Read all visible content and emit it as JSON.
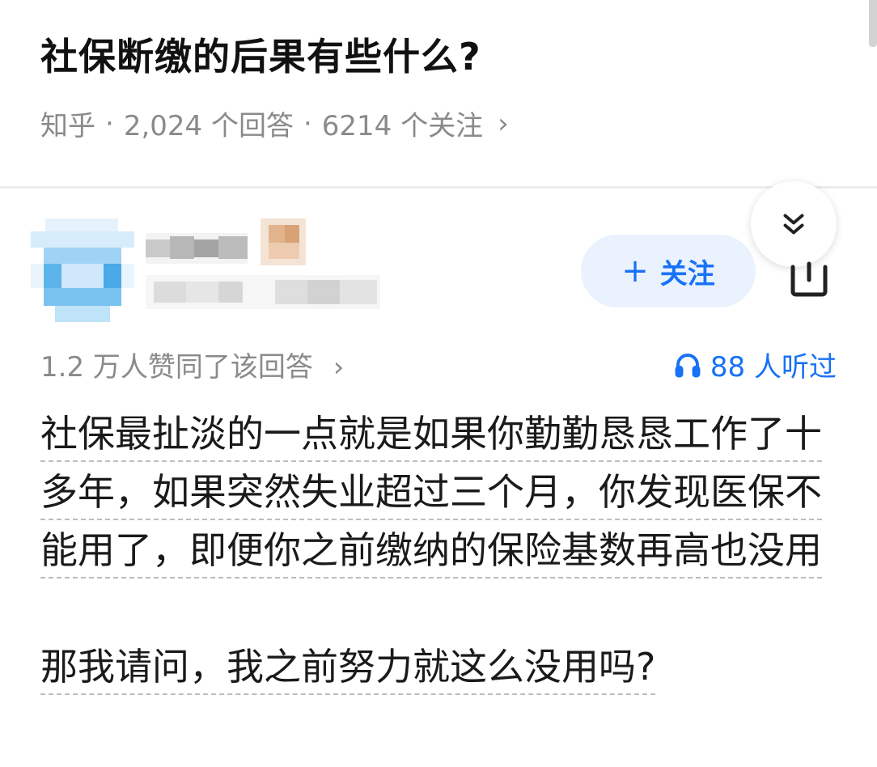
{
  "question": {
    "title": "社保断缴的后果有些什么?",
    "source": "知乎",
    "answers": "2,024 个回答",
    "followers": "6214 个关注",
    "separator": "·",
    "chevron": "›"
  },
  "answer": {
    "follow_label": "关注",
    "follow_plus": "+",
    "votes": "1.2 万人赞同了该回答",
    "vote_chevron": "›",
    "listen_count": "88 人听过",
    "paragraphs": [
      "社保最扯淡的一点就是如果你勤勤恳恳工作了十多年，如果突然失业超过三个月，你发现医保不能用了，即便你之前缴纳的保险基数再高也没用",
      "那我请问，我之前努力就这么没用吗?"
    ]
  },
  "icons": {
    "collapse": "double-chevron-down-icon",
    "share": "share-icon",
    "headphones": "headphones-icon"
  },
  "colors": {
    "accent": "#1772f6",
    "follow_bg": "#eaf2fe",
    "meta": "#8a8a8a"
  }
}
